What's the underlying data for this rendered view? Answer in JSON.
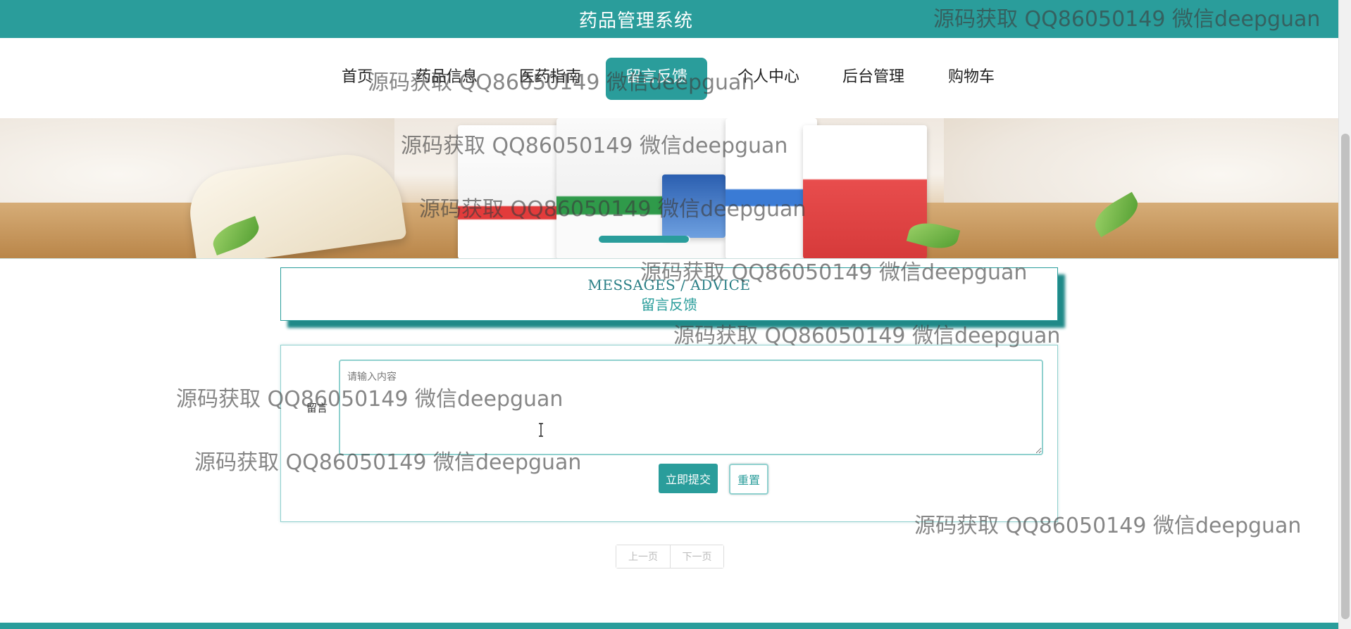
{
  "app": {
    "title": "药品管理系统"
  },
  "nav": {
    "items": [
      {
        "label": "首页"
      },
      {
        "label": "药品信息"
      },
      {
        "label": "医药指南"
      },
      {
        "label": "留言反馈"
      },
      {
        "label": "个人中心"
      },
      {
        "label": "后台管理"
      },
      {
        "label": "购物车"
      }
    ],
    "active_index": 3
  },
  "section": {
    "title_en": "MESSAGES / ADVICE",
    "title_cn": "留言反馈"
  },
  "form": {
    "label": "留言",
    "placeholder": "请输入内容",
    "value": "",
    "submit_label": "立即提交",
    "reset_label": "重置"
  },
  "pagination": {
    "prev_label": "上一页",
    "next_label": "下一页"
  },
  "watermark": {
    "text": "源码获取 QQ86050149 微信deepguan"
  },
  "colors": {
    "primary": "#2a9d9b",
    "primary_dark": "#1f8988",
    "border": "#8fd0ce"
  }
}
